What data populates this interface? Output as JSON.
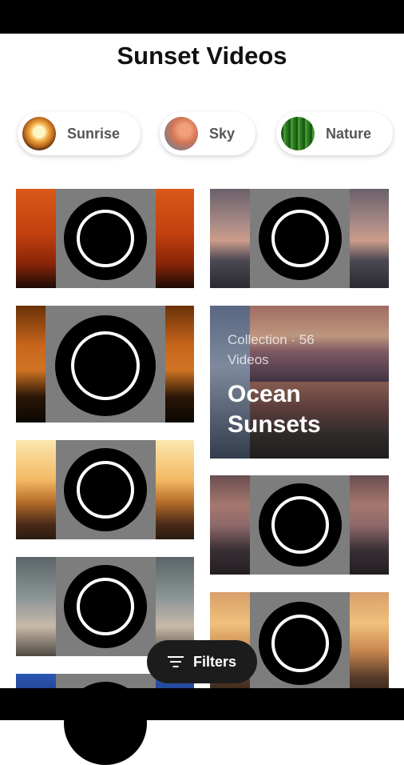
{
  "header": {
    "title": "Sunset Videos"
  },
  "chips": [
    {
      "label": "Sunrise",
      "icon": "sunrise-thumbnail"
    },
    {
      "label": "Sky",
      "icon": "sky-thumbnail"
    },
    {
      "label": "Nature",
      "icon": "nature-thumbnail"
    }
  ],
  "collection": {
    "meta": "Collection · 56 Videos",
    "title": "Ocean Sunsets"
  },
  "fab": {
    "label": "Filters",
    "icon": "filter-icon"
  },
  "colors": {
    "placeholder": "#7d7d7d",
    "play": "#000000",
    "fab": "#1c1c1c"
  }
}
